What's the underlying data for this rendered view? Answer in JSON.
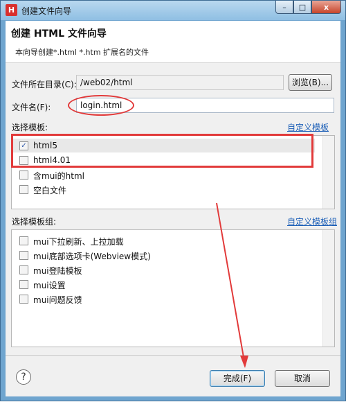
{
  "window": {
    "title": "创建文件向导",
    "app_icon_letter": "H",
    "controls": {
      "minimize": "–",
      "maximize": "□",
      "close": "x"
    }
  },
  "header": {
    "title": "创建 HTML 文件向导",
    "description": "本向导创建*.html *.htm 扩展名的文件"
  },
  "form": {
    "directory_label": "文件所在目录(C):",
    "directory_value": "/web02/html",
    "browse_label": "浏览(B)...",
    "filename_label": "文件名(F):",
    "filename_value": "login.html"
  },
  "templates": {
    "label": "选择模板:",
    "custom_link": "自定义模板",
    "items": [
      {
        "label": "html5",
        "checked": true
      },
      {
        "label": "html4.01",
        "checked": false
      },
      {
        "label": "含mui的html",
        "checked": false
      },
      {
        "label": "空白文件",
        "checked": false
      }
    ]
  },
  "template_groups": {
    "label": "选择模板组:",
    "custom_link": "自定义模板组",
    "items": [
      {
        "label": "mui下拉刷新、上拉加载",
        "checked": false
      },
      {
        "label": "mui底部选项卡(Webview模式)",
        "checked": false
      },
      {
        "label": "mui登陆模板",
        "checked": false
      },
      {
        "label": "mui设置",
        "checked": false
      },
      {
        "label": "mui问题反馈",
        "checked": false
      }
    ]
  },
  "footer": {
    "help_label": "?",
    "finish_label": "完成(F)",
    "cancel_label": "取消"
  },
  "colors": {
    "annotation": "#e23a3a",
    "link": "#1c5fb7"
  }
}
